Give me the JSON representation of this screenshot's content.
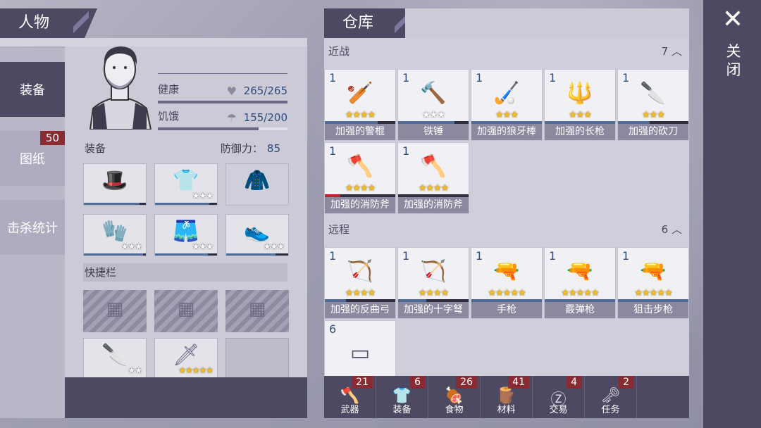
{
  "character": {
    "title": "人物",
    "tabs": [
      {
        "label": "装备",
        "badge": ""
      },
      {
        "label": "图纸",
        "badge": "50"
      },
      {
        "label": "击杀统计",
        "badge": ""
      }
    ],
    "stats": {
      "health_label": "健康",
      "health_value": "265/265",
      "health_fraction": 1.0,
      "hunger_label": "饥饿",
      "hunger_value": "155/200",
      "hunger_fraction": 0.775
    },
    "equip_label": "装备",
    "defense_label": "防御力：",
    "defense_value": "85",
    "quickbar_label": "快捷栏",
    "gear": [
      {
        "icon": "hat-icon",
        "glyph": "🎩",
        "stars": "",
        "durability": 0.9,
        "empty": false
      },
      {
        "icon": "shirt-icon",
        "glyph": "👕",
        "stars": "★★★",
        "durability": 0.88,
        "empty": false
      },
      {
        "icon": "jacket-slot-icon",
        "glyph": "🧥",
        "stars": "",
        "durability": 0,
        "empty": true
      },
      {
        "icon": "gloves-icon",
        "glyph": "🧤",
        "stars": "★★★",
        "durability": 0.95,
        "empty": false
      },
      {
        "icon": "shorts-icon",
        "glyph": "🩳",
        "stars": "★★★",
        "durability": 0.85,
        "empty": false
      },
      {
        "icon": "shoes-icon",
        "glyph": "👟",
        "stars": "★★★",
        "durability": 0.8,
        "empty": false
      }
    ],
    "quickbar": [
      {
        "icon": "locked-slot-icon",
        "glyph": "▦",
        "stars": "",
        "durability": 0
      },
      {
        "icon": "locked-slot-icon",
        "glyph": "▦",
        "stars": "",
        "durability": 0
      },
      {
        "icon": "locked-slot-icon",
        "glyph": "▦",
        "stars": "",
        "durability": 0
      },
      {
        "icon": "cleaver-icon",
        "glyph": "🔪",
        "stars": "★★",
        "durability": 0.9
      },
      {
        "icon": "katana-icon",
        "glyph": "🗡",
        "stars": "★★★★★",
        "durability": 1.0
      }
    ]
  },
  "storage": {
    "title": "仓库",
    "melee_label": "近战",
    "melee_count": "7",
    "ranged_label": "远程",
    "ranged_count": "6",
    "melee": [
      {
        "qty": "1",
        "name": "加强的警棍",
        "icon": "baton-icon",
        "glyph": "🏏",
        "stars": "★★★★",
        "gold": true,
        "durability": 0.75,
        "red": false
      },
      {
        "qty": "1",
        "name": "铁锤",
        "icon": "hammer-icon",
        "glyph": "🔨",
        "stars": "★★★",
        "gold": false,
        "durability": 0.8,
        "red": false
      },
      {
        "qty": "1",
        "name": "加强的狼牙棒",
        "icon": "mace-icon",
        "glyph": "🏑",
        "stars": "★★★",
        "gold": true,
        "durability": 1.0,
        "red": false
      },
      {
        "qty": "1",
        "name": "加强的长枪",
        "icon": "spear-icon",
        "glyph": "🔱",
        "stars": "★★★",
        "gold": true,
        "durability": 1.0,
        "red": false
      },
      {
        "qty": "1",
        "name": "加强的砍刀",
        "icon": "machete-icon",
        "glyph": "🔪",
        "stars": "★★★",
        "gold": true,
        "durability": 0.45,
        "red": false
      },
      {
        "qty": "1",
        "name": "加强的消防斧",
        "icon": "fire-axe-icon",
        "glyph": "🪓",
        "stars": "★★★★",
        "gold": true,
        "durability": 0.22,
        "red": true
      },
      {
        "qty": "1",
        "name": "加强的消防斧",
        "icon": "fire-axe-icon",
        "glyph": "🪓",
        "stars": "★★★★",
        "gold": true,
        "durability": 0.0,
        "red": false
      }
    ],
    "ranged": [
      {
        "qty": "1",
        "name": "加强的反曲弓",
        "icon": "recurve-bow-icon",
        "glyph": "🏹",
        "stars": "★★★★",
        "gold": true,
        "durability": 0.3,
        "red": false
      },
      {
        "qty": "1",
        "name": "加强的十字弩",
        "icon": "crossbow-icon",
        "glyph": "🏹",
        "stars": "★★★★",
        "gold": true,
        "durability": 0.4,
        "red": false
      },
      {
        "qty": "1",
        "name": "手枪",
        "icon": "pistol-icon",
        "glyph": "🔫",
        "stars": "★★★★★",
        "gold": true,
        "durability": 1.0,
        "red": false
      },
      {
        "qty": "1",
        "name": "霰弹枪",
        "icon": "shotgun-icon",
        "glyph": "🔫",
        "stars": "★★★★★",
        "gold": true,
        "durability": 1.0,
        "red": false
      },
      {
        "qty": "1",
        "name": "狙击步枪",
        "icon": "sniper-rifle-icon",
        "glyph": "🔫",
        "stars": "★★★★★",
        "gold": true,
        "durability": 1.0,
        "red": false
      },
      {
        "qty": "6",
        "name": "",
        "icon": "brick-icon",
        "glyph": "▭",
        "stars": "★★★★★",
        "gold": true,
        "durability": -1,
        "red": false
      }
    ],
    "tabs": [
      {
        "label": "武器",
        "badge": "21",
        "icon": "weapon-icon",
        "glyph": "🪓"
      },
      {
        "label": "装备",
        "badge": "6",
        "icon": "clothing-icon",
        "glyph": "👕"
      },
      {
        "label": "食物",
        "badge": "26",
        "icon": "food-icon",
        "glyph": "🍖"
      },
      {
        "label": "材料",
        "badge": "41",
        "icon": "material-icon",
        "glyph": "🪵"
      },
      {
        "label": "交易",
        "badge": "4",
        "icon": "trade-coin-icon",
        "glyph": "Ⓩ"
      },
      {
        "label": "任务",
        "badge": "2",
        "icon": "quest-key-icon",
        "glyph": "🗝"
      }
    ]
  },
  "close": {
    "icon": "close-icon",
    "glyph": "✕",
    "label": "关闭"
  }
}
